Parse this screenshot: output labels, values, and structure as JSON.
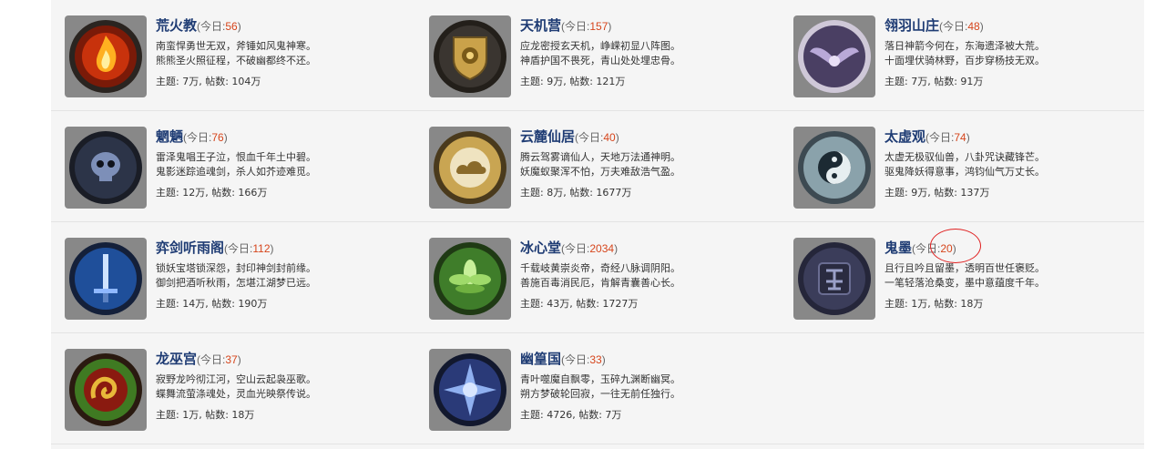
{
  "today_label": "今日:",
  "forums": [
    {
      "name": "荒火教",
      "today": "56",
      "desc1": "南蛮悍勇世无双，斧锤如风鬼神寒。",
      "desc2": "熊熊圣火照征程，不破幽都终不还。",
      "stats": "主题: 7万, 帖数: 104万",
      "icon": "flame-emblem-icon",
      "color": "#d83a14"
    },
    {
      "name": "天机营",
      "today": "157",
      "desc1": "应龙密授玄天机，峥嵘初显八阵图。",
      "desc2": "神盾护国不畏死，青山处处埋忠骨。",
      "stats": "主题: 9万, 帖数: 121万",
      "icon": "shield-emblem-icon",
      "color": "#b98c2a"
    },
    {
      "name": "翎羽山庄",
      "today": "48",
      "desc1": "落日神箭今何在，东海遗泽被大荒。",
      "desc2": "十面埋伏骑林野，百步穿杨技无双。",
      "stats": "主题: 7万, 帖数: 91万",
      "icon": "wings-emblem-icon",
      "color": "#6b5a86"
    },
    {
      "name": "魍魉",
      "today": "76",
      "desc1": "雷泽鬼唱王子泣，恨血千年土中碧。",
      "desc2": "鬼影迷踪追魂剑，杀人如芥迹难觅。",
      "stats": "主题: 12万, 帖数: 166万",
      "icon": "skull-emblem-icon",
      "color": "#3f4f6f"
    },
    {
      "name": "云麓仙居",
      "today": "40",
      "desc1": "腾云驾雾谪仙人，天地万法通神明。",
      "desc2": "妖魔蚁聚浑不怕，万夫难敌浩气盈。",
      "stats": "主题: 8万, 帖数: 1677万",
      "icon": "cloud-emblem-icon",
      "color": "#b3913a"
    },
    {
      "name": "太虚观",
      "today": "74",
      "desc1": "太虚无极驭仙兽，八卦咒诀藏锋芒。",
      "desc2": "驱鬼降妖得意事，鸿钧仙气万丈长。",
      "stats": "主题: 9万, 帖数: 137万",
      "icon": "yinyang-emblem-icon",
      "color": "#5c7c8a"
    },
    {
      "name": "弈剑听雨阁",
      "today": "112",
      "desc1": "锁妖宝塔锁深怨，封印神剑封前缘。",
      "desc2": "御剑把酒听秋雨，怎堪江湖梦已远。",
      "stats": "主题: 14万, 帖数: 190万",
      "icon": "sword-emblem-icon",
      "color": "#2f6fc8"
    },
    {
      "name": "冰心堂",
      "today": "2034",
      "desc1": "千载岐黄崇炎帝，奇经八脉调阴阳。",
      "desc2": "善施百毒消民厄，肯解青囊善心长。",
      "stats": "主题: 43万, 帖数: 1727万",
      "icon": "lotus-emblem-icon",
      "color": "#5aa13a"
    },
    {
      "name": "鬼墨",
      "today": "20",
      "desc1": "且行且吟且留墨，透明百世任褒贬。",
      "desc2": "一笔轻落沧桑变，墨中意蕴度千年。",
      "stats": "主题: 1万, 帖数: 18万",
      "icon": "ink-seal-emblem-icon",
      "color": "#4b4d6a"
    },
    {
      "name": "龙巫宫",
      "today": "37",
      "desc1": "寂野龙吟彻江河，空山云起袅巫歌。",
      "desc2": "蝶舞流萤涤魂处，灵血光映祭传说。",
      "stats": "主题: 1万, 帖数: 18万",
      "icon": "dragon-emblem-icon",
      "color": "#3f8a2a"
    },
    {
      "name": "幽篁国",
      "today": "33",
      "desc1": "青叶噬魔自飘零，玉碎九渊断幽冥。",
      "desc2": "朔方梦破轮回寂，一往无前任独行。",
      "stats": "主题: 4726, 帖数: 7万",
      "icon": "star-emblem-icon",
      "color": "#3a55a8"
    }
  ]
}
